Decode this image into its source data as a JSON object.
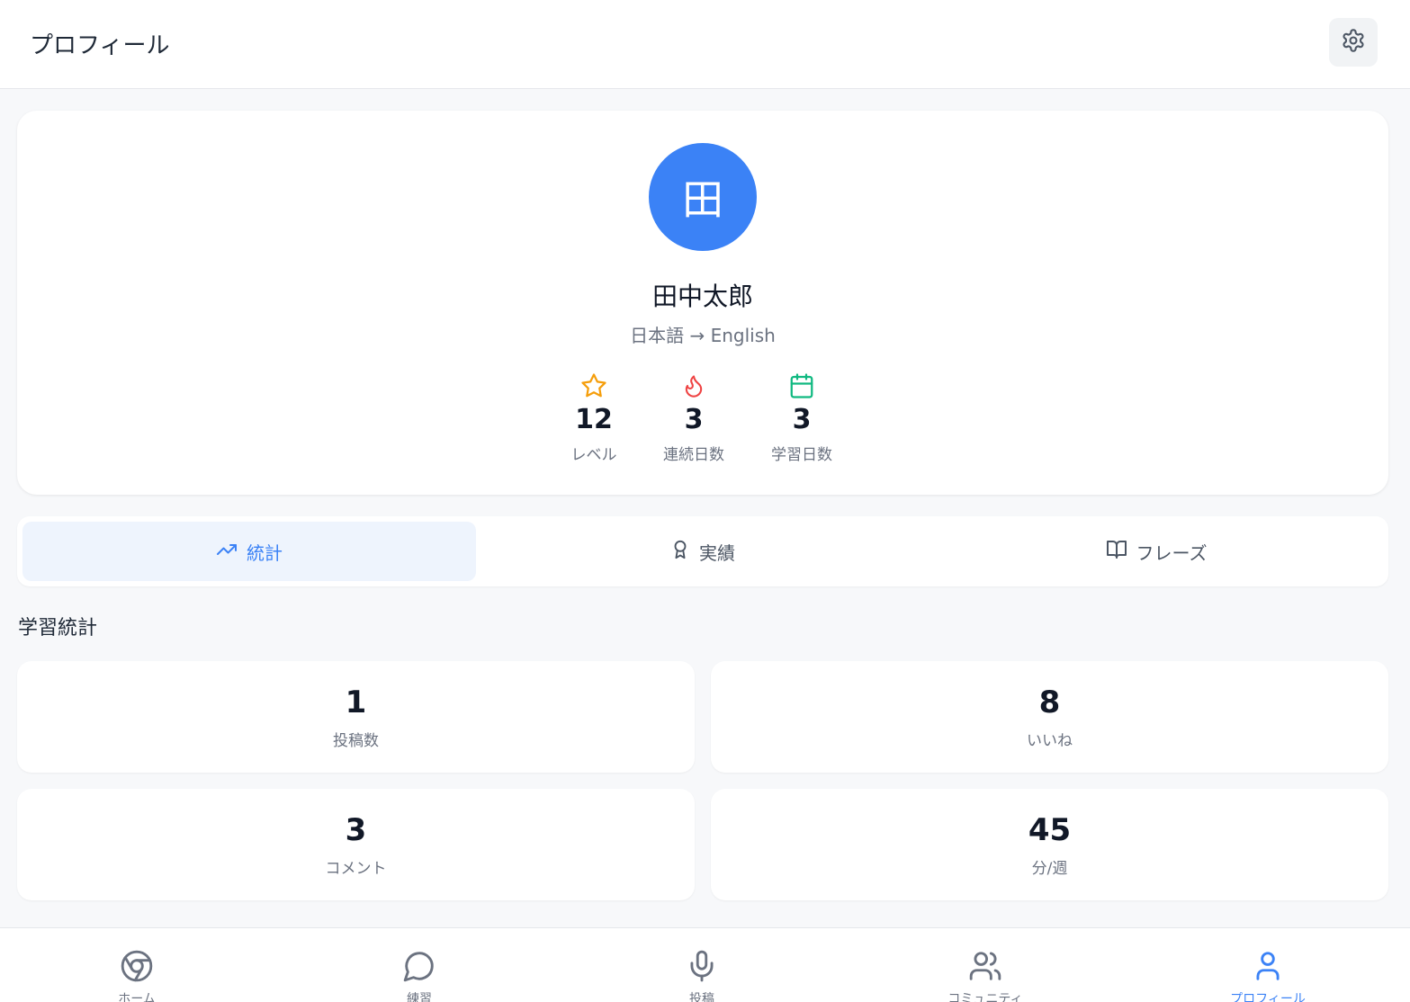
{
  "header": {
    "title": "プロフィール",
    "settings_icon": "gear-icon"
  },
  "profile": {
    "avatar_initial": "田",
    "avatar_color": "#3b82f6",
    "name": "田中太郎",
    "language_pair": "日本語 → English",
    "stats": [
      {
        "icon": "star-icon",
        "color": "#f59e0b",
        "value": "12",
        "label": "レベル"
      },
      {
        "icon": "flame-icon",
        "color": "#ef4444",
        "value": "3",
        "label": "連続日数"
      },
      {
        "icon": "calendar-icon",
        "color": "#10b981",
        "value": "3",
        "label": "学習日数"
      }
    ]
  },
  "tabs": [
    {
      "icon": "trending-up-icon",
      "label": "統計",
      "active": true
    },
    {
      "icon": "award-icon",
      "label": "実績",
      "active": false
    },
    {
      "icon": "book-open-icon",
      "label": "フレーズ",
      "active": false
    }
  ],
  "section_title": "学習統計",
  "learning_stats": [
    {
      "value": "1",
      "label": "投稿数"
    },
    {
      "value": "8",
      "label": "いいね"
    },
    {
      "value": "3",
      "label": "コメント"
    },
    {
      "value": "45",
      "label": "分/週"
    }
  ],
  "bottom_nav": [
    {
      "icon": "chrome-icon",
      "label": "ホーム",
      "active": false
    },
    {
      "icon": "message-circle-icon",
      "label": "練習",
      "active": false
    },
    {
      "icon": "mic-icon",
      "label": "投稿",
      "active": false
    },
    {
      "icon": "users-icon",
      "label": "コミュニティ",
      "active": false
    },
    {
      "icon": "user-icon",
      "label": "プロフィール",
      "active": true
    }
  ],
  "colors": {
    "accent": "#3b82f6",
    "active_tab_bg": "#eef4fd",
    "page_bg": "#f7f8fa"
  }
}
